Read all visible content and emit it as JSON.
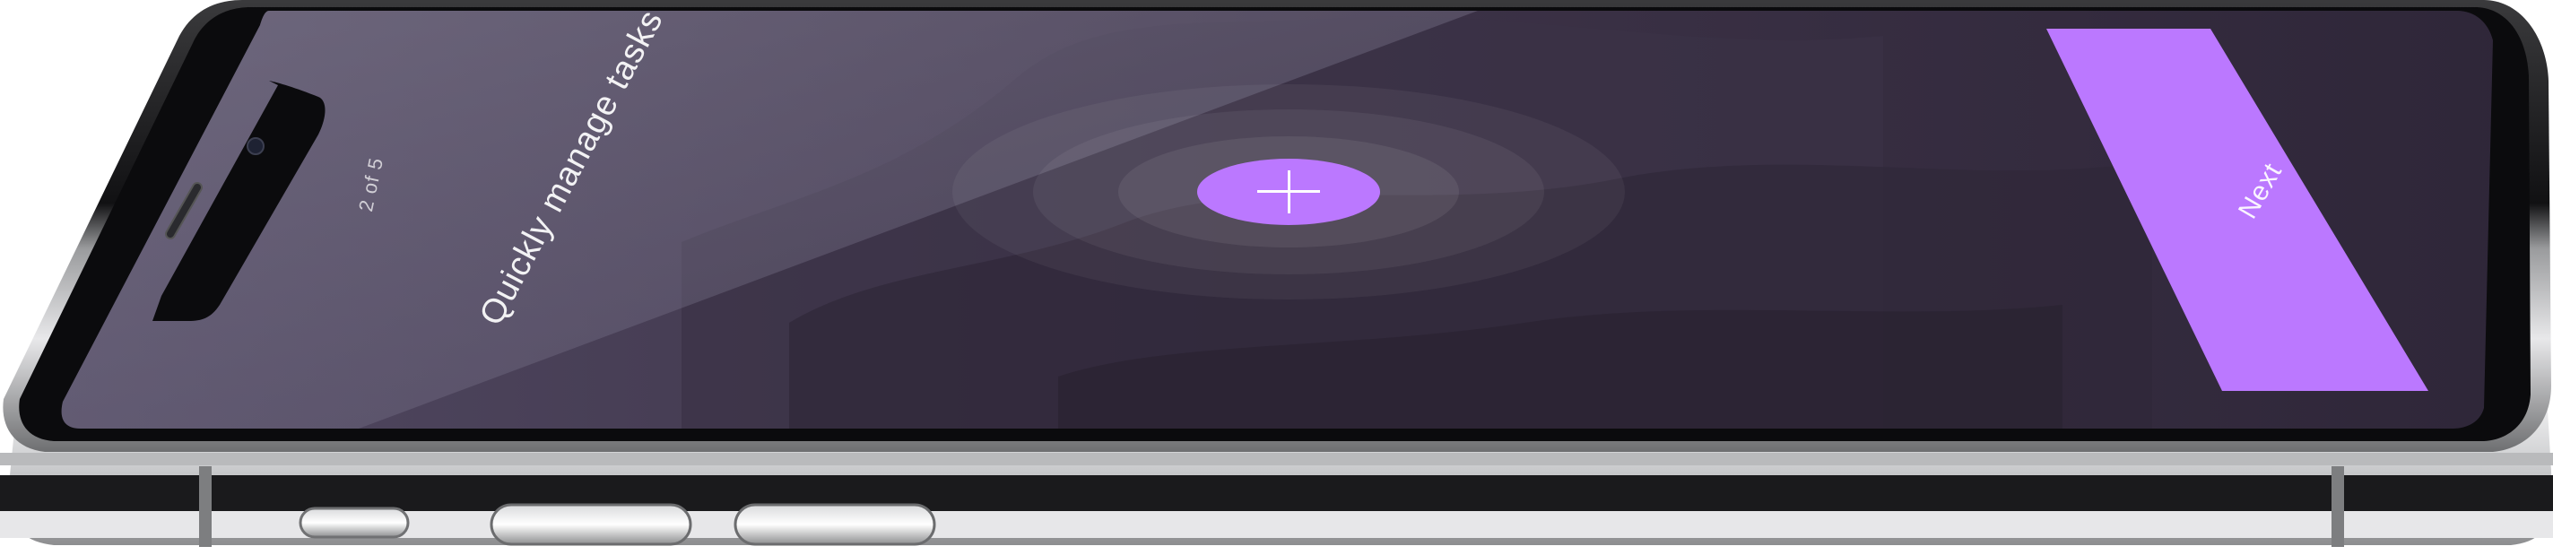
{
  "onboarding": {
    "pager_text": "2 of 5",
    "headline": "Quickly manage tasks",
    "add_button_glyph": "+",
    "next_label": "Next"
  },
  "colors": {
    "accent": "#bb78ff",
    "screen_dark": "#3a3145",
    "screen_light": "#6c6680",
    "bezel": "#0b0b0d",
    "frame_silver": "#c9cacc"
  },
  "icons": {
    "add": "plus-icon",
    "speaker": "earpiece-speaker-icon",
    "camera": "front-camera-icon"
  }
}
